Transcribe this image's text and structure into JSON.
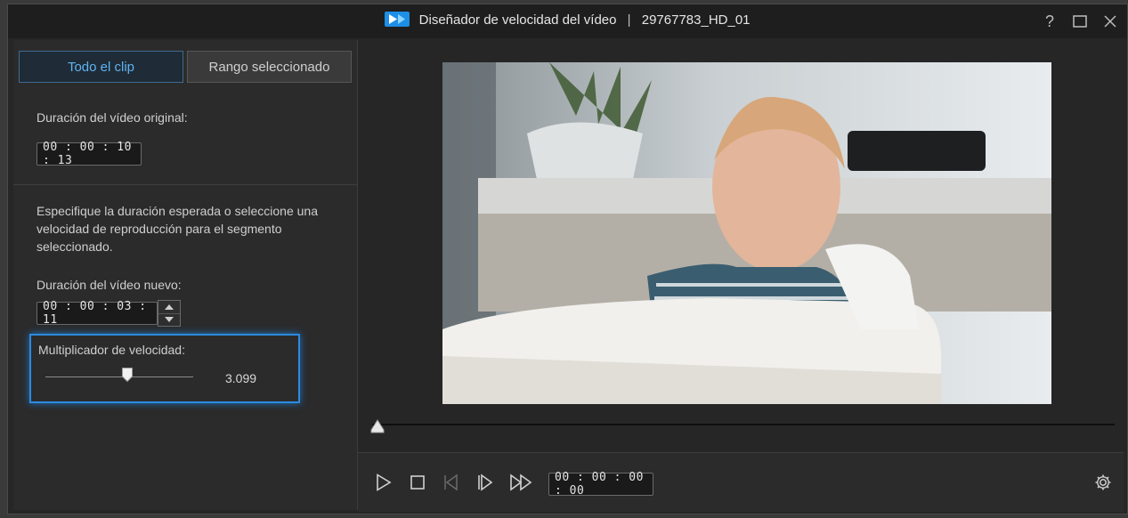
{
  "window": {
    "title": "Diseñador de velocidad del vídeo",
    "separator": "|",
    "clip_name": "29767783_HD_01",
    "help_glyph": "?",
    "icons": [
      "app-logo-icon",
      "help-icon",
      "maximize-icon",
      "close-icon"
    ]
  },
  "tabs": [
    {
      "label": "Todo el clip",
      "active": true
    },
    {
      "label": "Rango seleccionado",
      "active": false
    }
  ],
  "original": {
    "label": "Duración del vídeo original:",
    "value": "00 : 00 : 10 : 13"
  },
  "instructions": "Especifique la duración esperada o seleccione una velocidad de reproducción para el segmento seleccionado.",
  "new_duration": {
    "label": "Duración del vídeo nuevo:",
    "value": "00 : 00 : 03 : 11"
  },
  "speed": {
    "label": "Multiplicador de velocidad:",
    "value": "3.099"
  },
  "playback": {
    "timecode": "00 : 00 : 00 : 00",
    "position_fraction": 0,
    "icons": [
      "play-icon",
      "stop-icon",
      "previous-frame-icon",
      "next-frame-icon",
      "fast-forward-icon",
      "settings-icon"
    ]
  },
  "colors": {
    "accent": "#2d8be0",
    "active_tab_text": "#5fb3f2"
  }
}
